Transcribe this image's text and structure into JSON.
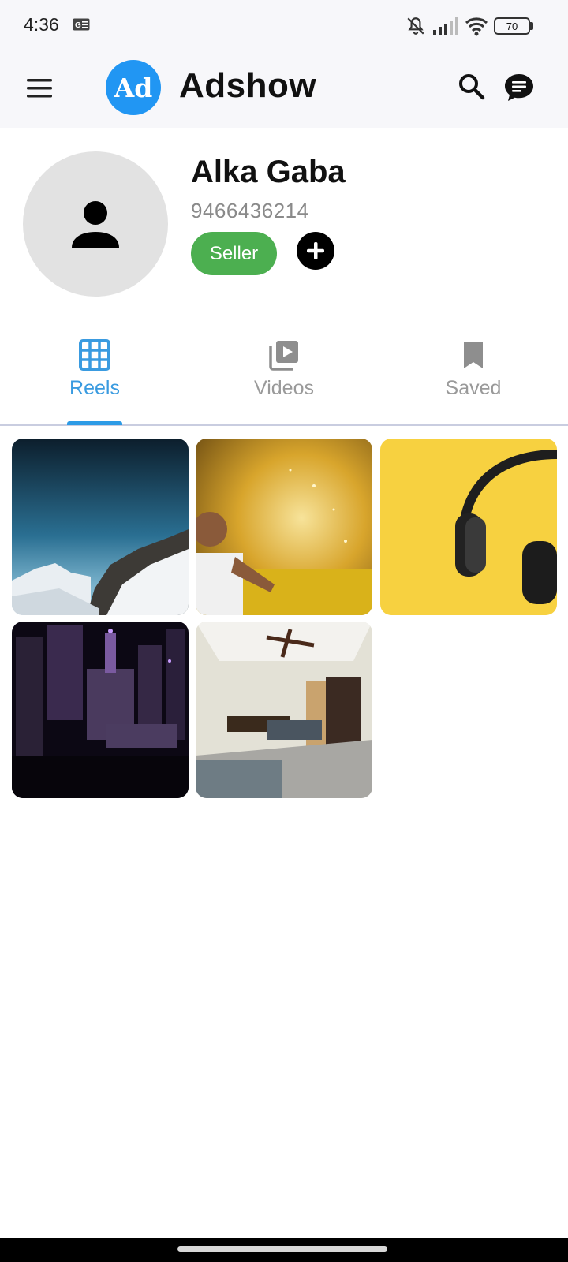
{
  "status_bar": {
    "time": "4:36",
    "battery": "70",
    "icons": [
      "g-notification-icon",
      "bell-off-icon",
      "signal-icon",
      "wifi-icon",
      "battery-icon"
    ]
  },
  "app_bar": {
    "logo_text": "Ad",
    "title": "Adshow",
    "logo_color": "#2196f3",
    "icons": [
      "menu-icon",
      "search-icon",
      "chat-icon"
    ]
  },
  "profile": {
    "name": "Alka Gaba",
    "phone": "9466436214",
    "role_badge": "Seller",
    "badge_color": "#4caf50"
  },
  "tabs": [
    {
      "label": "Reels",
      "icon": "grid-icon",
      "active": true
    },
    {
      "label": "Videos",
      "icon": "video-library-icon",
      "active": false
    },
    {
      "label": "Saved",
      "icon": "bookmark-icon",
      "active": false
    }
  ],
  "accent_color": "#2d9be6",
  "reels": [
    {
      "subject": "snowy-mountain"
    },
    {
      "subject": "child-golden-splash"
    },
    {
      "subject": "headphones-yellow"
    },
    {
      "subject": "city-night-purple"
    },
    {
      "subject": "bedroom-interior"
    }
  ]
}
